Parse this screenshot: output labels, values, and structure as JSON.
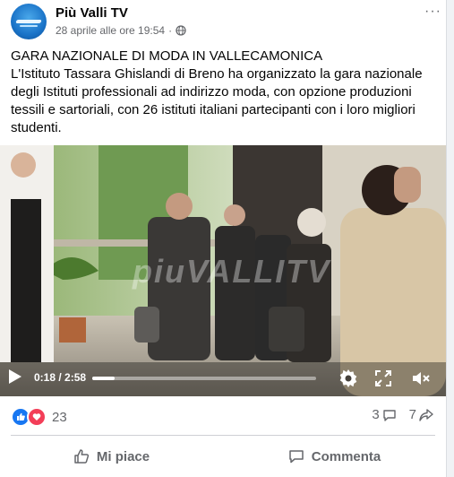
{
  "post": {
    "page_name": "Più Valli TV",
    "timestamp": "28 aprile alle ore 19:54",
    "separator": "·",
    "headline": "GARA NAZIONALE DI MODA IN VALLECAMONICA",
    "body": "L'Istituto Tassara Ghislandi di Breno ha organizzato la gara nazionale degli Istituti professionali ad indirizzo moda, con opzione produzioni tessili e sartoriali, con 26 istituti italiani partecipanti con i loro migliori studenti."
  },
  "video": {
    "watermark": "piuVALLITV",
    "time_display": "0:18 / 2:58",
    "progress": 0.101
  },
  "stats": {
    "reaction_count": "23",
    "comments_count": "3",
    "shares_count": "7"
  },
  "actions": {
    "like_label": "Mi piace",
    "comment_label": "Commenta"
  },
  "icons": {
    "privacy": "globe-icon",
    "more": "more-options-icon",
    "play": "play-icon",
    "settings": "gear-icon",
    "fullscreen": "fullscreen-icon",
    "volume": "volume-muted-icon",
    "comment": "comment-icon",
    "share": "share-icon",
    "like": "thumbs-up-icon"
  },
  "colors": {
    "like_blue": "#1877f2",
    "love_red": "#f33e58",
    "text_secondary": "#65676b"
  }
}
